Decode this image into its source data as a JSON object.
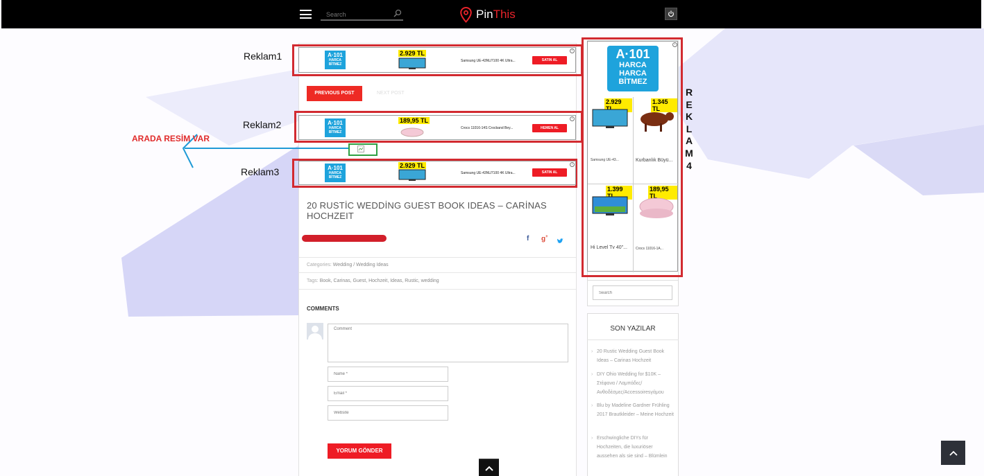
{
  "header": {
    "search_placeholder": "Search",
    "brand_prefix": "Pin",
    "brand_suffix": "This"
  },
  "annotations": {
    "reklam1": "Reklam1",
    "reklam2": "Reklam2",
    "reklam3": "Reklam3",
    "reklam4_letters": [
      "R",
      "E",
      "K",
      "L",
      "A",
      "M",
      "4"
    ],
    "arada": "ARADA RESİM VAR"
  },
  "ad_brand": {
    "line1": "A·101",
    "line2": "HARCA",
    "line3": "HARCA",
    "line4": "BİTMEZ"
  },
  "ads": [
    {
      "price": "2.929 TL",
      "title": "Samsung UE-43NU7100 4K Ultra...",
      "button": "SATIN AL"
    },
    {
      "price": "189,95 TL",
      "title": "Crocs 11016-14S Crocband Bey...",
      "button": "HEMEN AL"
    },
    {
      "price": "2.929 TL",
      "title": "Samsung UE-43NU7100 4K Ultra...",
      "button": "SATIN AL"
    }
  ],
  "nav": {
    "previous": "PREVIOUS POST",
    "next": "NEXT POST"
  },
  "post": {
    "title": "20 RUSTİC WEDDİNG GUEST BOOK IDEAS – CARİNAS HOCHZEIT",
    "categories_label": "Categories:",
    "categories_value": "Wedding / Wedding Ideas",
    "tags_label": "Tags:",
    "tags_value": "Book, Carinas, Guest, Hochzeit, Ideas, Rustic, wedding"
  },
  "share_icons": [
    "facebook-icon",
    "google-plus-icon",
    "twitter-icon"
  ],
  "comments": {
    "heading": "COMMENTS",
    "comment_placeholder": "Comment",
    "name_placeholder": "Name *",
    "email_placeholder": "Email *",
    "website_placeholder": "Website",
    "submit": "YORUM GÖNDER"
  },
  "side_ad": {
    "products": [
      {
        "price": "2.929 TL",
        "title": "Samsung UE-43..."
      },
      {
        "price": "1.345 TL",
        "title": "Kurbanlık Büyü..."
      },
      {
        "price": "1.399 TL",
        "title": "Hi Level Tv 40\"..."
      },
      {
        "price": "189,95 TL",
        "title": "Crocs 11016-1A..."
      }
    ]
  },
  "sidebar": {
    "search_placeholder": "Search",
    "son_yazilar_title": "SON YAZILAR",
    "posts": [
      "20 Rustic Wedding Guest Book Ideas – Carinas Hochzeit",
      "DIY Ohio Wedding for $10K – Στέφανα / Λαμπάδες/ Ανθοδέσμες/Accessoiresγάμου",
      "Blu by Madeline Gardner Frühling 2017 Brautkleider – Meine Hochzeit",
      "Erschwingliche DIYs für Hochzeiten, die luxuriöser aussehen als sie sind – Blümlein"
    ]
  },
  "colors": {
    "accent_red": "#ee1c25",
    "frame_red": "#d22a30",
    "frame_green": "#2ea043",
    "arrow_blue": "#1f9ad6",
    "shape_lavender": "#d6d6f7"
  }
}
